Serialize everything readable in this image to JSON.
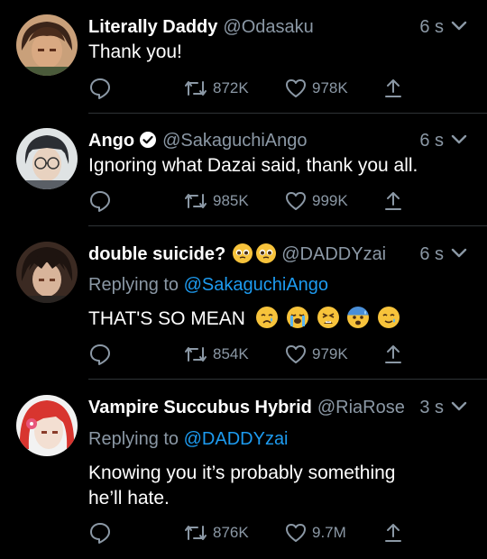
{
  "tweets": [
    {
      "name": "Literally Daddy",
      "handle": "@Odasaku",
      "time": "6 s",
      "text": "Thank you!",
      "retweets": "872K",
      "likes": "978K"
    },
    {
      "name": "Ango",
      "handle": "@SakaguchiAngo",
      "time": "6 s",
      "text": "Ignoring what Dazai said, thank you all.",
      "retweets": "985K",
      "likes": "999K",
      "verified": true
    },
    {
      "name": "double suicide?",
      "handle": "@DADDYzai",
      "time": "6 s",
      "reply_prefix": "Replying to",
      "reply_to": "@SakaguchiAngo",
      "text": "THAT'S SO MEAN",
      "retweets": "854K",
      "likes": "979K",
      "name_emojis": [
        "pleading-face",
        "pleading-face"
      ],
      "text_emojis": [
        "crying-face",
        "loudly-crying-face",
        "tired-face",
        "anxious-face-with-sweat",
        "smiling-face-with-tear"
      ]
    },
    {
      "name": "Vampire Succubus Hybrid",
      "handle": "@RiaRose",
      "time": "3 s",
      "reply_prefix": "Replying to",
      "reply_to": "@DADDYzai",
      "text_line1": "Knowing you it’s probably something",
      "text_line2": "he’ll hate.",
      "retweets": "876K",
      "likes": "9.7M"
    }
  ],
  "colors": {
    "background": "#000000",
    "secondary_text": "#8b98a5",
    "link": "#1d9bf0",
    "separator": "#2f3336"
  }
}
